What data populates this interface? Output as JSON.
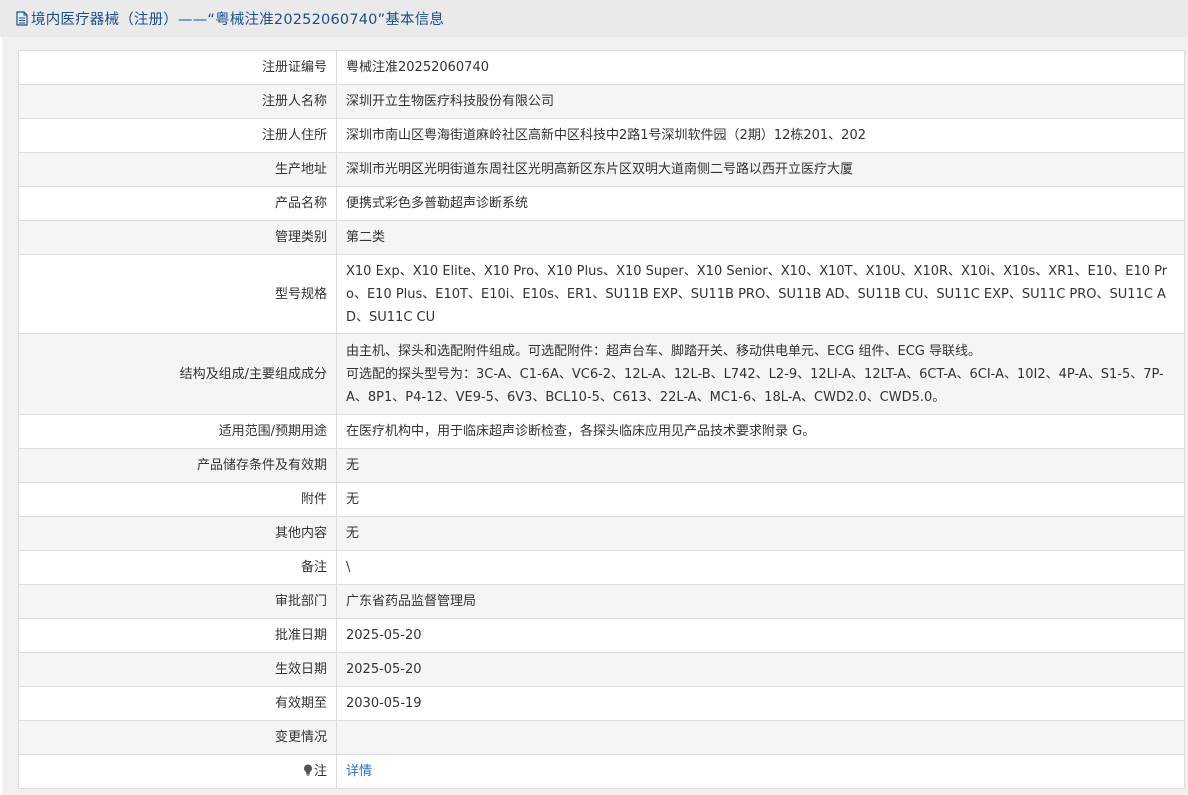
{
  "header": {
    "title": "境内医疗器械（注册）——“粤械注准20252060740”基本信息"
  },
  "rows": [
    {
      "label": "注册证编号",
      "value": "粤械注准20252060740"
    },
    {
      "label": "注册人名称",
      "value": "深圳开立生物医疗科技股份有限公司"
    },
    {
      "label": "注册人住所",
      "value": "深圳市南山区粤海街道麻岭社区高新中区科技中2路1号深圳软件园（2期）12栋201、202"
    },
    {
      "label": "生产地址",
      "value": "深圳市光明区光明街道东周社区光明高新区东片区双明大道南侧二号路以西开立医疗大厦"
    },
    {
      "label": "产品名称",
      "value": "便携式彩色多普勒超声诊断系统"
    },
    {
      "label": "管理类别",
      "value": "第二类"
    },
    {
      "label": "型号规格",
      "value": "X10 Exp、X10 Elite、X10 Pro、X10 Plus、X10 Super、X10 Senior、X10、X10T、X10U、X10R、X10i、X10s、XR1、E10、E10 Pro、E10 Plus、E10T、E10i、E10s、ER1、SU11B EXP、SU11B PRO、SU11B AD、SU11B CU、SU11C EXP、SU11C PRO、SU11C AD、SU11C CU"
    },
    {
      "label": "结构及组成/主要组成成分",
      "value_line1": "由主机、探头和选配附件组成。可选配附件：超声台车、脚踏开关、移动供电单元、ECG 组件、ECG 导联线。",
      "value_line2": "可选配的探头型号为：3C-A、C1-6A、VC6-2、12L-A、12L-B、L742、L2-9、12LI-A、12LT-A、6CT-A、6CI-A、10I2、4P-A、S1-5、7P-A、8P1、P4-12、VE9-5、6V3、BCL10-5、C613、22L-A、MC1-6、18L-A、CWD2.0、CWD5.0。"
    },
    {
      "label": "适用范围/预期用途",
      "value": "在医疗机构中，用于临床超声诊断检查，各探头临床应用见产品技术要求附录 G。"
    },
    {
      "label": "产品储存条件及有效期",
      "value": "无"
    },
    {
      "label": "附件",
      "value": "无"
    },
    {
      "label": "其他内容",
      "value": "无"
    },
    {
      "label": "备注",
      "value": "\\"
    },
    {
      "label": "审批部门",
      "value": "广东省药品监督管理局"
    },
    {
      "label": "批准日期",
      "value": "2025-05-20"
    },
    {
      "label": "生效日期",
      "value": "2025-05-20"
    },
    {
      "label": "有效期至",
      "value": "2030-05-19"
    },
    {
      "label": "变更情况",
      "value": ""
    },
    {
      "label": "注",
      "value": "详情",
      "icon": "lightbulb-icon"
    }
  ],
  "colors": {
    "header_text": "#1c4f8c",
    "link": "#2a6fbf",
    "row_alt": "#f5f5f5",
    "border": "#dcdcdc"
  }
}
